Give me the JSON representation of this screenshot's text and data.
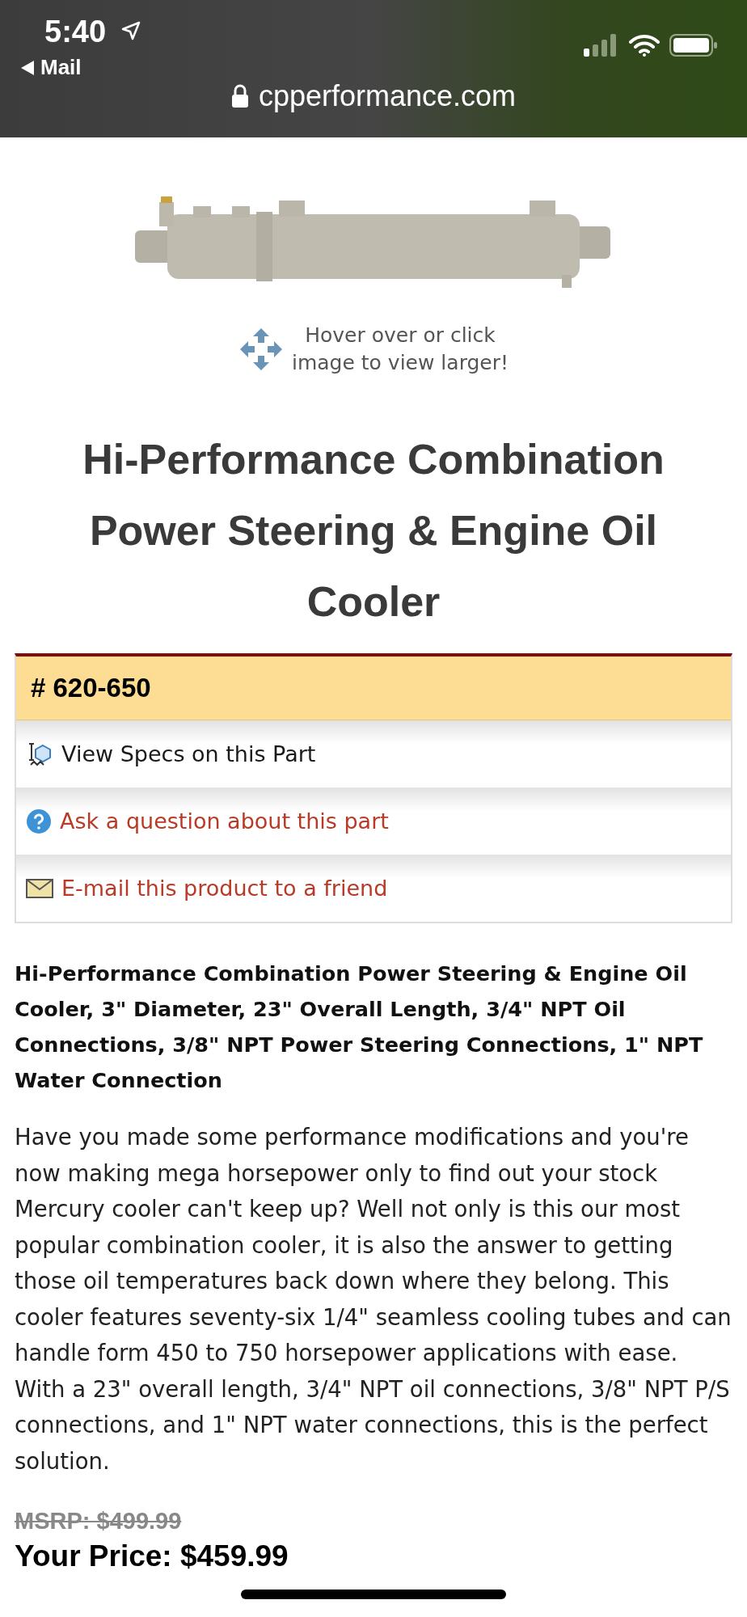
{
  "status_bar": {
    "time": "5:40",
    "back_label": "Mail",
    "url": "cpperformance.com"
  },
  "product_image": {
    "kind": "picture",
    "hint": [
      "Hover over or click",
      "image to view larger!"
    ]
  },
  "title": "Hi-Performance Combination Power Steering & Engine Oil Cooler",
  "part_box": {
    "part_number": "# 620-650",
    "links": [
      {
        "kind": "specs",
        "label": "View Specs on this Part"
      },
      {
        "kind": "question",
        "label": "Ask a question about this part"
      },
      {
        "kind": "email",
        "label": "E-mail this product to a friend"
      }
    ]
  },
  "summary": "Hi-Performance Combination Power Steering & Engine Oil Cooler, 3\" Diameter, 23\" Overall Length, 3/4\" NPT Oil Connections, 3/8\" NPT Power Steering Connections, 1\" NPT Water Connection",
  "description": "Have you made some performance modifications and you're now making mega horsepower only to find out your stock Mercury cooler can't keep up? Well not only is this our most popular combination cooler, it is also the answer to getting those oil temperatures back down where they belong. This cooler features seventy-six 1/4\" seamless cooling tubes and can handle form 450 to 750 horsepower applications with ease. With a 23\" overall length, 3/4\" NPT oil connections, 3/8\" NPT P/S connections, and 1\" NPT water connections, this is the perfect solution.",
  "pricing": {
    "msrp": "MSRP: $499.99",
    "your_price": "Your Price: $459.99"
  }
}
